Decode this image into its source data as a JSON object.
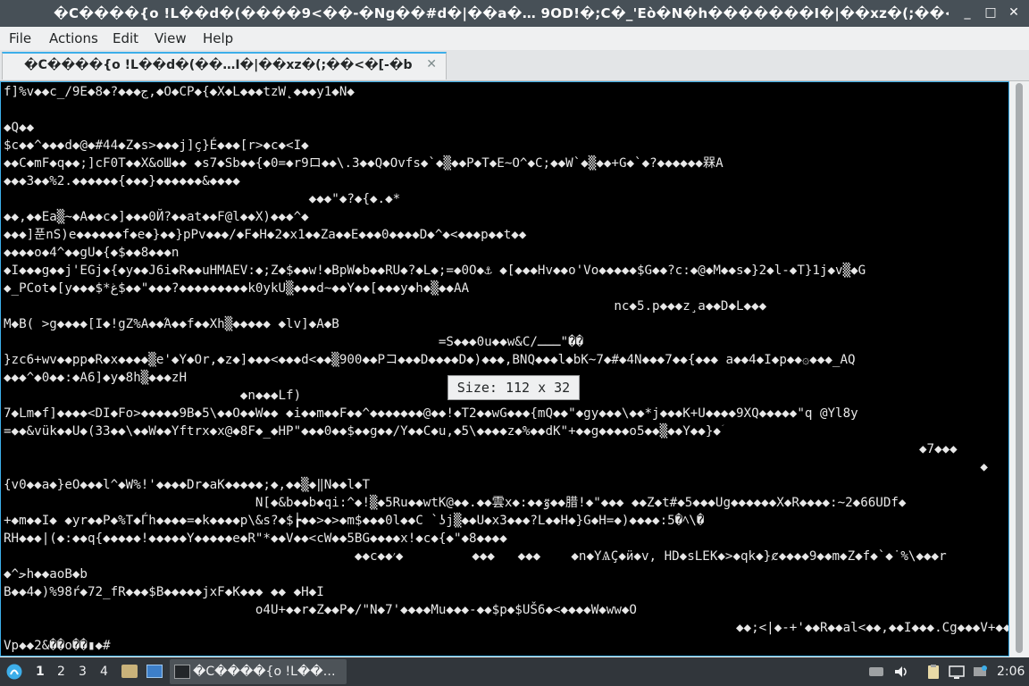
{
  "window": {
    "title": "�C����{o !L��d�(����9<��-�Ng��#d�|��a�…  9OD!�;C�_'Eò�N�h�������I�|��xz�(;��<�[-�b",
    "minimize_glyph": "_",
    "maximize_glyph": "□",
    "close_glyph": "✕"
  },
  "menu": {
    "file": "File",
    "actions": "Actions",
    "edit": "Edit",
    "view": "View",
    "help": "Help"
  },
  "tab": {
    "label": "�C����{o !L��d�(��…I�|��xz�(;��<�[-�b",
    "close_glyph": "✕"
  },
  "terminal": {
    "lines": [
      "f]%v◆◆c_/9E◆8◆?◆◆◆ج,◆O◆CP◆{◆X◆L◆◆◆tzW˛◆◆◆y1◆N◆",
      "",
      "◆Q◆◆",
      "$c◆◆^◆◆◆d◆@◆#44◆Z◆s>◆◆◆j]ç}É◆◆◆[r>◆c◆<I◆",
      "◆◆C◆mF◆q◆◆;]cF0T◆◆X&oШ◆◆ ◆s7◆Sb◆◆{◆0=◆r9ロ◆◆\\.3◆◆Q◆Ovfs◆`◆▒◆◆P◆T◆E~O^◆C;◆◆W`◆▒◆◆+G◆`◆?◆◆◆◆◆◆槑A",
      "◆◆◆3◆◆%2.◆◆◆◆◆◆{◆◆◆}◆◆◆◆◆◆&◆◆◆◆",
      "                                        ◆◆◆\"◆?◆{◆.◆*",
      "◆◆,◆◆Ea▒~◆A◆◆c◆]◆◆◆0Й?◆◆at◆◆F@l◆◆X)◆◆◆^◆",
      "◆◆◆]푼nS)e◆◆◆◆◆◆f◆e◆}◆◆}pPv◆◆◆/◆F◆H◆2◆x1◆◆Za◆◆E◆◆◆0◆◆◆◆D◆^◆<◆◆◆p◆◆t◆◆",
      "◆◆◆◆o◆4^◆◆gU◆{◆$◆◆8◆◆◆n",
      "◆I◆◆◆g◆◆j'EGj◆{◆y◆◆J6i◆R◆◆uHMAEV:◆;Z◆$◆◆w!◆BpW◆b◆◆RU◆?◆L◆;=◆0O◆⚓ ◆[◆◆◆Hv◆◆o'Vo◆◆◆◆◆$G◆◆?c:◆@◆M◆◆s◆}2◆l-◆T}1j◆v▒◆G",
      "◆_PCot◆[y◆◆◆$*ﻍ$◆◆\"◆◆◆?◆◆◆◆◆◆◆◆◆k0ykU▒◆◆◆d~◆◆Y◆◆[◆◆◆y◆h◆▒◆◆AA",
      "                                                                                nc◆5.p◆◆◆z¸a◆◆D◆L◆◆◆",
      "M◆B( >g◆◆◆◆[I◆!gZ%A◆◆Ά◆◆f◆◆Xh▒◆◆◆◆◆ ◆lv]◆A◆B",
      "                                                         =S◆◆◆0u◆◆w&C/ـــ\"��",
      "}zc6+wv◆◆pp◆R◆x◆◆◆◆▒e'◆Y◆Or,◆z◆]◆◆◆<◆◆◆d<◆◆▒900◆◆Pコ◆◆◆D◆◆◆◆D◆)◆◆◆,BNQ◆◆◆l◆bK~7◆#◆4N◆◆◆7◆◆{◆◆◆ a◆◆4◆I◆p◆◆۞◆◆◆_AQ",
      "◆◆◆^◆0◆◆:◆A6]◆y◆8h▒◆◆◆zH",
      "                               ◆n◆◆◆Lf)",
      "7◆Lm◆f]◆◆◆◆<DI◆Fo>◆◆◆◆◆9B◆5\\◆◆O◆◆W◆◆ ◆i◆◆m◆◆F◆◆^◆◆◆◆◆◆◆@◆◆!◆T2◆◆wG◆◆◆{mQ◆◆\"◆gy◆◆◆\\◆◆*j◆◆◆K+U◆◆◆◆9XQ◆◆◆◆◆\"q @Yl8y",
      "=◆◆&vük◆◆U◆(33◆◆\\◆◆W◆◆Yftrx◆x@◆8F◆_◆HP\"◆◆◆0◆◆$◆◆g◆◆/Y◆◆C◆u,◆5\\◆◆◆◆z◆%◆◆dK\"+◆◆g◆◆◆◆o5◆◆▒◆◆Y◆◆}◆ؘ",
      "                                                                                                                        ◆7◆◆◆",
      "                                                                                                                                ◆",
      "{v0◆◆a◆}eO◆◆◆l^◆W%!'◆◆◆◆Dr◆aK◆◆◆◆◆;◆,◆◆▒◆‖N◆◆l◆T",
      "                                 N[◆&b◆◆b◆qi:^◆!▒◆5Ru◆◆wtK@◆◆.◆◆雲x◆:◆◆ٷ◆◆腊!◆\"◆◆◆ ◆◆Z◆t#◆5◆◆◆Ug◆◆◆◆◆◆X◆R◆◆◆◆:~2◆66UDf◆",
      "+◆m◆◆I◆ ◆yr◆◆P◆%T◆Ѓh◆◆◆◆=◆k◆◆◆◆p\\&s?◆$┢◆◆>◆>◆m$◆◆◆0l◆◆C `ʖj▒◆◆U◆x3◆◆◆?L◆◆H◆}G◆H=◆)◆◆◆◆:5�ﾍ\\�",
      "RH◆◆◆|(◆:◆◆q{◆◆◆◆◆!◆◆◆◆◆Y◆◆◆◆◆e◆R\"*◆◆V◆◆<cW◆◆5BG◆◆◆◆x!◆c◆{◆\"◆8◆◆◆◆",
      "                                              ◆◆c◆◆׳◆         ◆◆◆   ◆◆◆    ◆n◆ΥѦÇ◆ӥ◆v, HD◆sLEK◆>◆qk◆}ȼ◆◆◆◆9◆◆m◆Z◆f◆`◆˙%\\◆◆◆r",
      "◆^ﺣh◆◆aoB◆b",
      "B◆◆4◆)%98ŕ◆72_fR◆◆◆$B◆◆◆◆◆jxF◆K◆◆◆ ◆◆ ◆H◆I",
      "                                 o4U+◆◆r◆Z◆◆P◆/\"N◆7'◆◆◆◆Mu◆◆◆-◆◆$p◆$UŠ6◆<◆◆◆◆W◆ww◆O",
      "                                                                                                ◆◆;<|◆-+'◆◆R◆◆al<◆◆,◆◆I◆◆◆.Cg◆◆◆V+◆◆",
      "Vp◆◆2&��o��▮◆#"
    ]
  },
  "size_tooltip": "Size: 112 x 32",
  "taskbar": {
    "workspaces": [
      "1",
      "2",
      "3",
      "4"
    ],
    "active_workspace": "1",
    "task_label": "�C����{o !L��…",
    "clock": "2:06"
  },
  "colors": {
    "accent": "#3daee9",
    "terminal_bg": "#000000",
    "terminal_fg": "#e8e8e8",
    "titlebar_bg": "#475057",
    "taskbar_bg": "#31363b"
  }
}
